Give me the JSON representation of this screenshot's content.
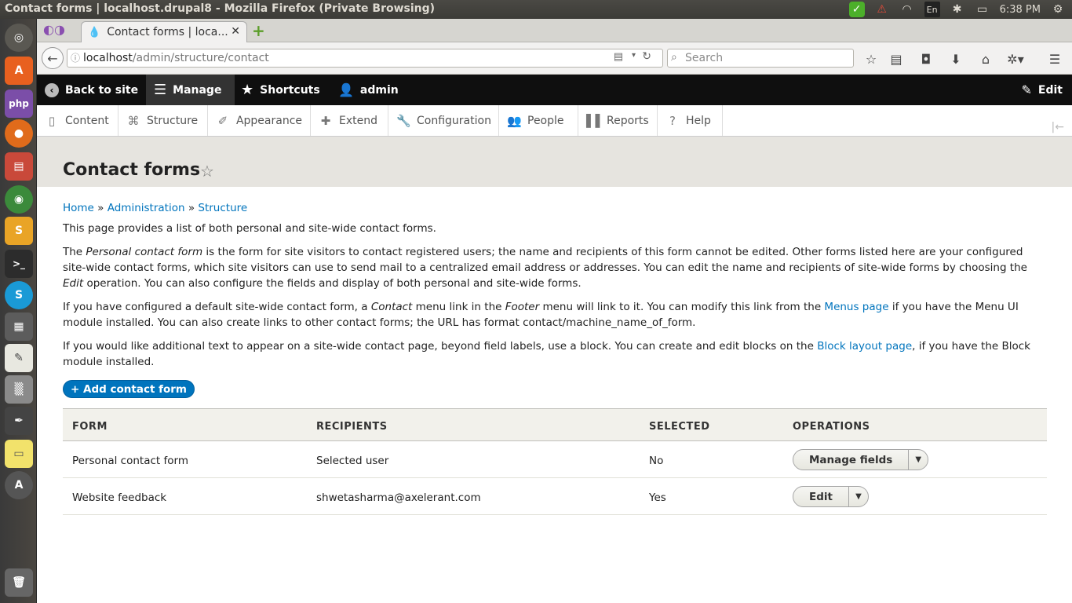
{
  "os": {
    "window_title": "Contact forms | localhost.drupal8 - Mozilla Firefox (Private Browsing)",
    "keyboard_layout": "En",
    "clock": "6:38 PM"
  },
  "launcher": {
    "items": [
      "ubuntu-dash",
      "software-center",
      "php-storm",
      "firefox",
      "file-manager",
      "chrome",
      "slack",
      "terminal",
      "skype",
      "calculator",
      "text-editor",
      "image-viewer",
      "inkscape",
      "sticky-notes",
      "system-updater",
      "trash"
    ]
  },
  "browser": {
    "tab_title": "Contact forms | loca...",
    "url_host": "localhost",
    "url_path": "/admin/structure/contact",
    "search_placeholder": "Search"
  },
  "toolbar": {
    "back_to_site": "Back to site",
    "manage": "Manage",
    "shortcuts": "Shortcuts",
    "user": "admin",
    "edit": "Edit"
  },
  "admin_menu": {
    "items": [
      {
        "label": "Content"
      },
      {
        "label": "Structure"
      },
      {
        "label": "Appearance"
      },
      {
        "label": "Extend"
      },
      {
        "label": "Configuration"
      },
      {
        "label": "People"
      },
      {
        "label": "Reports"
      },
      {
        "label": "Help"
      }
    ]
  },
  "page": {
    "title": "Contact forms",
    "breadcrumb": [
      "Home",
      "Administration",
      "Structure"
    ],
    "breadcrumb_sep": "»",
    "intro": "This page provides a list of both personal and site-wide contact forms.",
    "p2": {
      "a": "The ",
      "b": "Personal contact form",
      "c": " is the form for site visitors to contact registered users; the name and recipients of this form cannot be edited. Other forms listed here are your configured site-wide contact forms, which site visitors can use to send mail to a centralized email address or addresses. You can edit the name and recipients of site-wide forms by choosing the ",
      "d": "Edit",
      "e": " operation. You can also configure the fields and display of both personal and site-wide forms."
    },
    "p3": {
      "a": "If you have configured a default site-wide contact form, a ",
      "b": "Contact",
      "c": " menu link in the ",
      "d": "Footer",
      "e": " menu will link to it. You can modify this link from the ",
      "link": "Menus page",
      "f": " if you have the Menu UI module installed. You can also create links to other contact forms; the URL has format contact/machine_name_of_form."
    },
    "p4": {
      "a": "If you would like additional text to appear on a site-wide contact page, beyond field labels, use a block. You can create and edit blocks on the ",
      "link": "Block layout page",
      "b": ", if you have the Block module installed."
    },
    "add_button": "+ Add contact form"
  },
  "table": {
    "headers": [
      "FORM",
      "RECIPIENTS",
      "SELECTED",
      "OPERATIONS"
    ],
    "rows": [
      {
        "form": "Personal contact form",
        "recipients": "Selected user",
        "selected": "No",
        "operation": "Manage fields"
      },
      {
        "form": "Website feedback",
        "recipients": "shwetasharma@axelerant.com",
        "selected": "Yes",
        "operation": "Edit"
      }
    ]
  }
}
